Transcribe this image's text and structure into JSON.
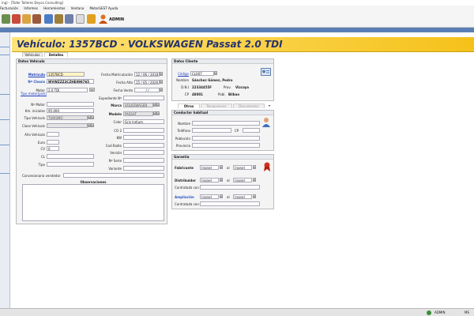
{
  "window": {
    "title": "ing) - [Taller Talleres Deyco Consulting]"
  },
  "menu": [
    "Facturación",
    "Informes",
    "Herramientas",
    "Ventana",
    "MotorGEST Ayuda"
  ],
  "toolbar": {
    "user": "ADMIN",
    "icons": [
      "calendar-icon",
      "car-icon",
      "person-icon",
      "tools-icon",
      "document-icon",
      "box-icon",
      "report-icon",
      "pencil-icon",
      "mail-icon",
      "user-icon"
    ]
  },
  "vehicle": {
    "title": "Vehículo: 1357BCD - VOLKSWAGEN Passat 2.0 TDI"
  },
  "tabs": {
    "vehiculos": "Vehículos",
    "detalles": "Detalles"
  },
  "datos_vehiculo": {
    "header": "Datos Vehículo",
    "matricula_label": "Matrícula",
    "matricula": "1357BCD",
    "chasis_label": "Nº Chasis",
    "chasis": "WVWZZZ3CZHE098765",
    "motor_label": "Motor",
    "motor": "2.0 TDI",
    "motor_btn": "F2",
    "tipo_motor_link": "Tipo motor(pick)",
    "fecha_matriculacion_label": "Fecha Matriculación",
    "fecha_matriculacion": "12 / 06 / 2018",
    "fecha_alta_label": "Fecha Alta",
    "fecha_alta": "15 / 05 / 2026",
    "fecha_venta_label": "Fecha Venta",
    "fecha_venta": "/ /",
    "expediente_label": "Expediente Nº",
    "marca_label": "Marca",
    "marca": "VOLKSWAGEN",
    "modelo_label": "Modelo",
    "modelo": "PASSAT",
    "color_label": "Color",
    "color": "Gris Indium",
    "co2_label": "CO 2",
    "kw_label": "KW",
    "cod_radio_label": "Cod.Radio",
    "version_label": "Versión",
    "num_serie_label": "Nº Serie",
    "variante_label": "Variante",
    "num_motor_label": "Nº Motor",
    "km_iniciales_label": "Km. iniciales",
    "km_iniciales": "95.000",
    "tipo_vehiculo_label": "Tipo Vehículo",
    "tipo_vehiculo": "TURISMO",
    "clase_vehiculo_label": "Clase Vehículo",
    "anio_label": "Año Vehículo",
    "euro_label": "Euro",
    "cv_label": "CV",
    "cv": "0",
    "cl_label": "CL",
    "tipo_label": "Tipo",
    "concesionario_label": "Concesionario vendedor",
    "observaciones_label": "Observaciones"
  },
  "datos_cliente": {
    "header": "Datos Cliente",
    "codigo_label": "Código",
    "codigo": "CL007",
    "nombre_label": "Nombre",
    "nombre": "Sánchez Gómez, Pedro",
    "dni_label": "D.N.I",
    "dni": "22334455F",
    "prov_label": "Prov.",
    "prov": "Vizcaya",
    "cp_label": "CP",
    "cp": "48001",
    "pobl_label": "Pobl.",
    "pobl": "Bilbao"
  },
  "subtabs": [
    "Otros",
    "Recepciones",
    "Documentos"
  ],
  "conductor": {
    "header": "Conductor habitual",
    "nombre_label": "Nombre",
    "telefono_label": "Teléfono",
    "cp_label": "CP",
    "poblacion_label": "Población",
    "provincia_label": "Provincia"
  },
  "garantia": {
    "header": "Garantía",
    "fabricante_label": "Fabricante",
    "distribuidor_label": "Distribuidor",
    "ampliacion_label": "Ampliación",
    "none": "(none)",
    "al": "al",
    "contratada_label": "Contratada con"
  },
  "status": {
    "user": "ADMIN",
    "right": "MS"
  },
  "colors": {
    "title_band": "#f5c21a",
    "title_text": "#26336e",
    "blue_band": "#5b7fb5",
    "link": "#1f3fbf"
  }
}
